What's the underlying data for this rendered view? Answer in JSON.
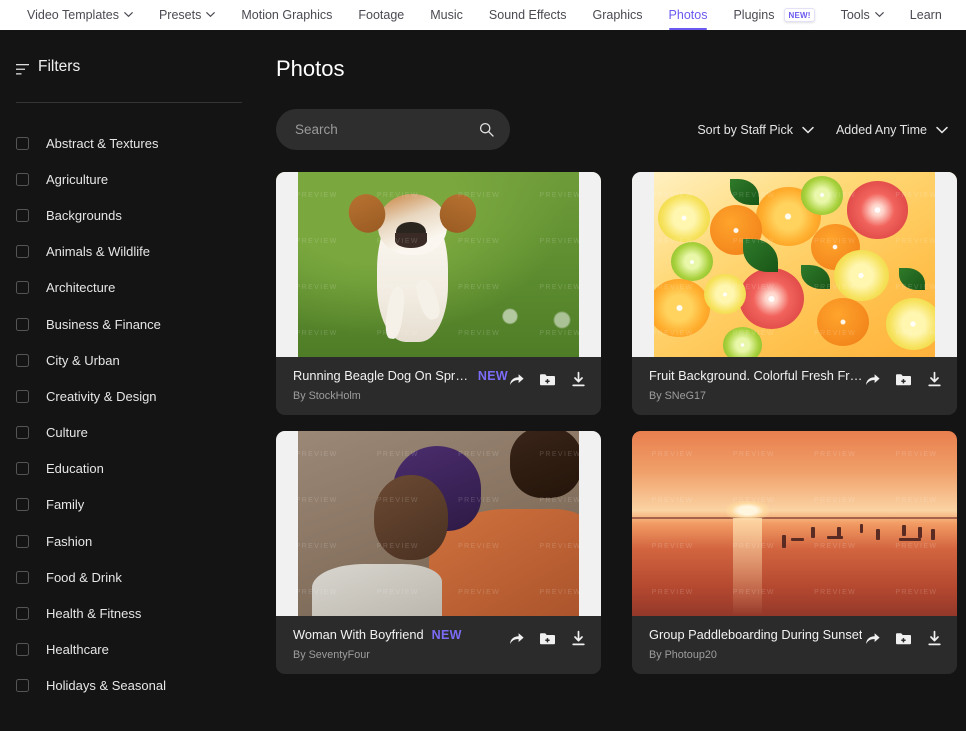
{
  "topnav": {
    "items": [
      {
        "label": "Video Templates",
        "caret": true,
        "active": false,
        "badge": null
      },
      {
        "label": "Presets",
        "caret": true,
        "active": false,
        "badge": null
      },
      {
        "label": "Motion Graphics",
        "caret": false,
        "active": false,
        "badge": null
      },
      {
        "label": "Footage",
        "caret": false,
        "active": false,
        "badge": null
      },
      {
        "label": "Music",
        "caret": false,
        "active": false,
        "badge": null
      },
      {
        "label": "Sound Effects",
        "caret": false,
        "active": false,
        "badge": null
      },
      {
        "label": "Graphics",
        "caret": false,
        "active": false,
        "badge": null
      },
      {
        "label": "Photos",
        "caret": false,
        "active": true,
        "badge": null
      },
      {
        "label": "Plugins",
        "caret": false,
        "active": false,
        "badge": "NEW!"
      },
      {
        "label": "Tools",
        "caret": true,
        "active": false,
        "badge": null
      },
      {
        "label": "Learn",
        "caret": false,
        "active": false,
        "badge": null
      }
    ],
    "active_color": "#6a5af0"
  },
  "sidebar": {
    "title": "Filters",
    "icon": "filter-icon",
    "categories": [
      "Abstract & Textures",
      "Agriculture",
      "Backgrounds",
      "Animals & Wildlife",
      "Architecture",
      "Business & Finance",
      "City & Urban",
      "Creativity & Design",
      "Culture",
      "Education",
      "Family",
      "Fashion",
      "Food & Drink",
      "Health & Fitness",
      "Healthcare",
      "Holidays & Seasonal"
    ]
  },
  "main": {
    "page_title": "Photos",
    "search": {
      "value": "",
      "placeholder": "Search",
      "icon": "search-icon"
    },
    "sort_dropdown": {
      "label": "Sort by Staff Pick",
      "icon": "chevron-down-icon"
    },
    "date_dropdown": {
      "label": "Added Any Time",
      "icon": "chevron-down-icon"
    },
    "watermark_text": "PREVIEW",
    "actions": {
      "share": "share-icon",
      "add_to_collection": "folder-plus-icon",
      "download": "download-icon"
    },
    "cards": [
      {
        "title": "Running Beagle Dog On Spring...",
        "author": "By StockHolm",
        "badge": "NEW",
        "art": "dog"
      },
      {
        "title": "Fruit Background. Colorful Fresh Fruits",
        "author": "By SNeG17",
        "badge": null,
        "art": "fruit"
      },
      {
        "title": "Woman With Boyfriend",
        "author": "By SeventyFour",
        "badge": "NEW",
        "art": "woman"
      },
      {
        "title": "Group Paddleboarding During Sunset",
        "author": "By Photoup20",
        "badge": null,
        "art": "sunset"
      }
    ]
  },
  "colors": {
    "page_background": "#141414",
    "card_background": "#2b2b2b",
    "accent_purple": "#6a5af0",
    "badge_purple": "#7b6cf6",
    "nav_background": "#ffffff",
    "search_background": "#2e2e2e"
  }
}
